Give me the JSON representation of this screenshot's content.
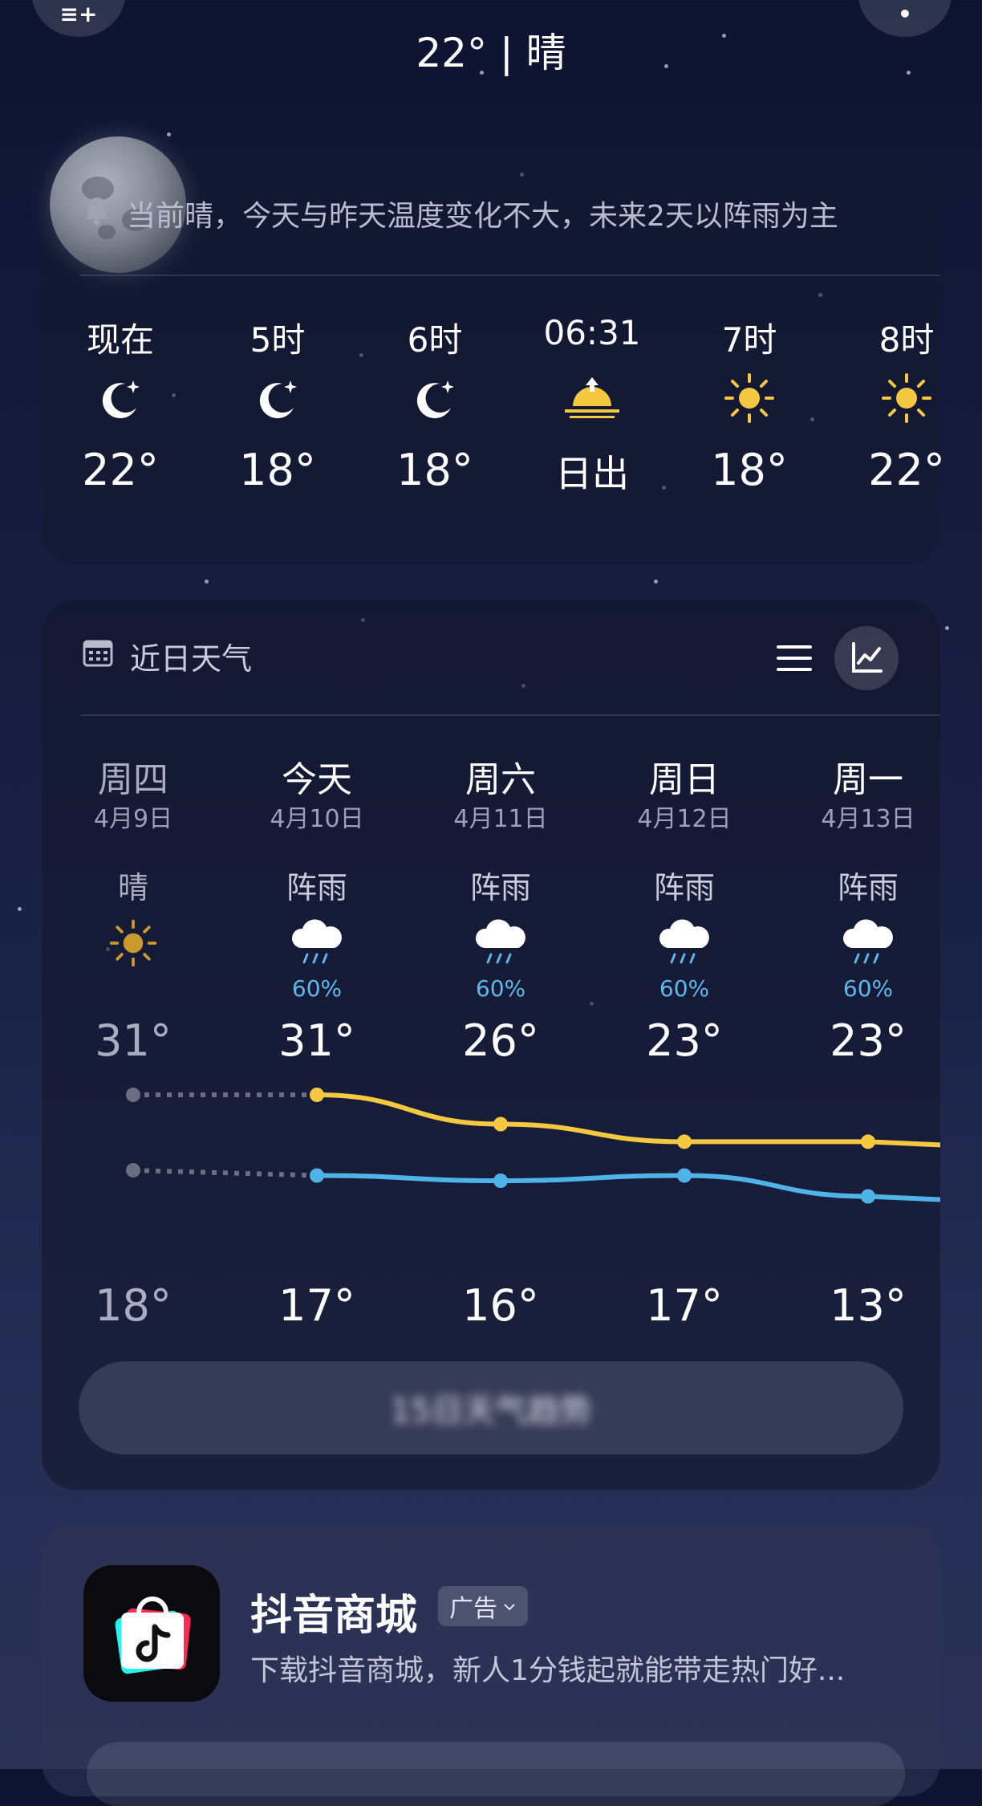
{
  "header": {
    "title": "22° | 晴",
    "left_button_icon": "add-city-icon",
    "right_button_icon": "more-menu-icon"
  },
  "notice": {
    "icon": "bell-icon",
    "text": "当前晴，今天与昨天温度变化不大，未来2天以阵雨为主"
  },
  "hourly": [
    {
      "label": "现在",
      "icon": "moon-night-icon",
      "value": "22°"
    },
    {
      "label": "5时",
      "icon": "moon-night-icon",
      "value": "18°"
    },
    {
      "label": "6时",
      "icon": "moon-night-icon",
      "value": "18°"
    },
    {
      "label": "06:31",
      "icon": "sunrise-icon",
      "value": "日出"
    },
    {
      "label": "7时",
      "icon": "sun-icon",
      "value": "18°"
    },
    {
      "label": "8时",
      "icon": "sun-icon",
      "value": "22°"
    }
  ],
  "daily_section": {
    "title": "近日天气",
    "calendar_icon": "calendar-icon",
    "list_view_icon": "list-view-icon",
    "chart_view_icon": "chart-view-icon"
  },
  "daily": [
    {
      "day": "周四",
      "date": "4月9日",
      "condition": "晴",
      "icon": "sun-icon",
      "rain": "",
      "high": "31°",
      "low": "18°",
      "past": true
    },
    {
      "day": "今天",
      "date": "4月10日",
      "condition": "阵雨",
      "icon": "rain-cloud-icon",
      "rain": "60%",
      "high": "31°",
      "low": "17°",
      "past": false
    },
    {
      "day": "周六",
      "date": "4月11日",
      "condition": "阵雨",
      "icon": "rain-cloud-icon",
      "rain": "60%",
      "high": "26°",
      "low": "16°",
      "past": false
    },
    {
      "day": "周日",
      "date": "4月12日",
      "condition": "阵雨",
      "icon": "rain-cloud-icon",
      "rain": "60%",
      "high": "23°",
      "low": "17°",
      "past": false
    },
    {
      "day": "周一",
      "date": "4月13日",
      "condition": "阵雨",
      "icon": "rain-cloud-icon",
      "rain": "60%",
      "high": "23°",
      "low": "13°",
      "past": false
    }
  ],
  "chart_data": {
    "type": "line",
    "categories": [
      "4月9日",
      "4月10日",
      "4月11日",
      "4月12日",
      "4月13日"
    ],
    "series": [
      {
        "values": [
          31,
          31,
          26,
          23,
          23
        ]
      },
      {
        "values": [
          18,
          17,
          16,
          17,
          13
        ]
      }
    ],
    "colors": {
      "high": "#f5c842",
      "low": "#4fb3e8",
      "past": "#6a6e80"
    }
  },
  "blurred_button": {
    "text": "15日天气趋势"
  },
  "ad": {
    "app_name": "抖音商城",
    "badge": "广告",
    "description": "下载抖音商城，新人1分钱起就能带走热门好...",
    "icon": "douyin-mall-icon"
  }
}
